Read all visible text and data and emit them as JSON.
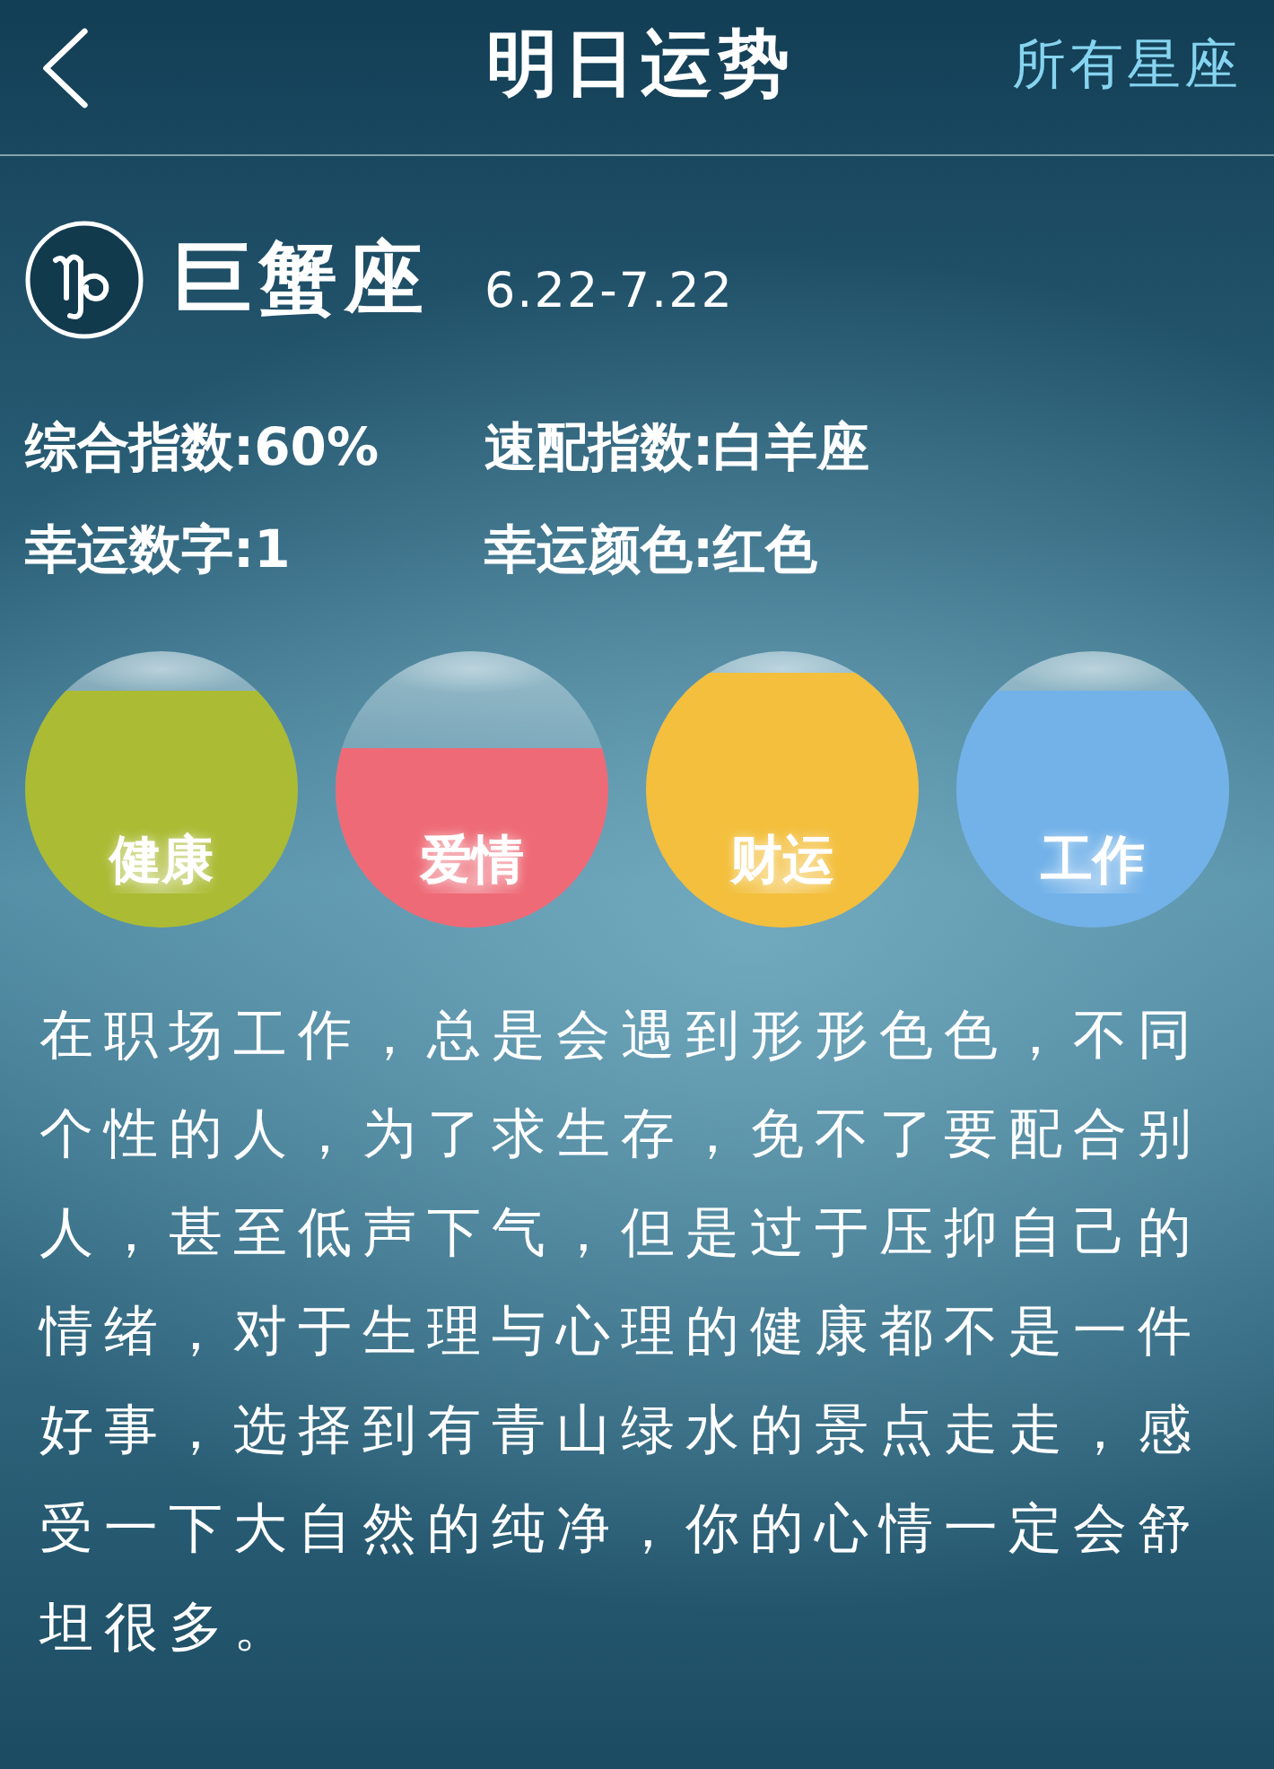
{
  "header": {
    "title": "明日运势",
    "link": "所有星座"
  },
  "sign": {
    "name": "巨蟹座",
    "dates": "6.22-7.22"
  },
  "stats": [
    "综合指数:60%",
    "速配指数:白羊座",
    "幸运数字:1",
    "幸运颜色:红色"
  ],
  "meters": [
    {
      "label": "健康",
      "level": 0.86,
      "color": "#abbb33"
    },
    {
      "label": "爱情",
      "level": 0.65,
      "color": "#ee6a76"
    },
    {
      "label": "财运",
      "level": 0.92,
      "color": "#f3bf3c"
    },
    {
      "label": "工作",
      "level": 0.86,
      "color": "#72b2e9"
    }
  ],
  "description": "在职场工作，总是会遇到形形色色，不同个性的人，为了求生存，免不了要配合别人，甚至低声下气，但是过于压抑自己的情绪，对于生理与心理的健康都不是一件好事，选择到有青山绿水的景点走走，感受一下大自然的纯净，你的心情一定会舒坦很多。"
}
